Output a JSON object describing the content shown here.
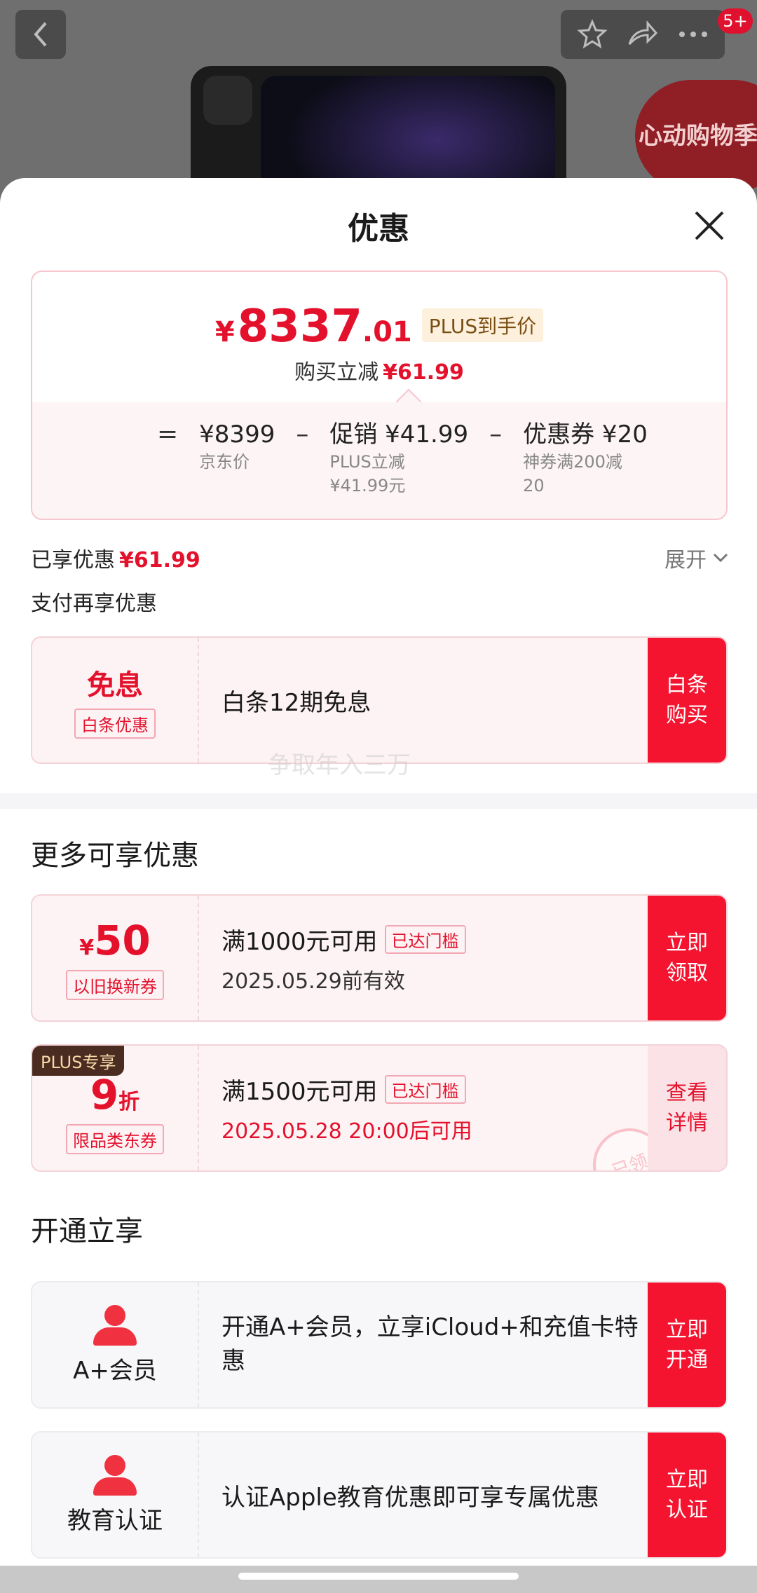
{
  "background": {
    "badge": "5+",
    "promo_text": "心动购物季"
  },
  "sheet": {
    "title": "优惠"
  },
  "price": {
    "symbol": "¥",
    "integer": "8337",
    "decimal": ".01",
    "plus_tag": "PLUS到手价",
    "sub_label": "购买立减",
    "sub_value": "¥61.99",
    "formula": {
      "eq": "=",
      "minus": "–",
      "items": [
        {
          "value": "¥8399",
          "desc": "京东价"
        },
        {
          "value": "促销 ¥41.99",
          "desc": "PLUS立减\n¥41.99元"
        },
        {
          "value": "优惠券 ¥20",
          "desc": "神券满200减\n20"
        }
      ]
    }
  },
  "enjoyed": {
    "label": "已享优惠",
    "value": "¥61.99",
    "expand": "展开"
  },
  "pay_section": {
    "title": "支付再享优惠",
    "card": {
      "left_title": "免息",
      "left_tag": "白条优惠",
      "text": "白条12期免息",
      "button": "白条\n购买"
    }
  },
  "watermark": "争取年入三万",
  "more_section": {
    "title": "更多可享优惠",
    "coupons": [
      {
        "amount_symbol": "¥",
        "amount": "50",
        "tag": "以旧换新券",
        "title": "满1000元可用",
        "threshold": "已达门槛",
        "sub": "2025.05.29前有效",
        "button": "立即\n领取"
      },
      {
        "corner": "PLUS专享",
        "amount": "9",
        "unit": "折",
        "tag": "限品类东券",
        "title": "满1500元可用",
        "threshold": "已达门槛",
        "sub": "2025.05.28 20:00后可用",
        "button": "查看\n详情",
        "stamp": "已领"
      }
    ]
  },
  "open_section": {
    "title": "开通立享",
    "items": [
      {
        "label": "A+会员",
        "text": "开通A+会员，立享iCloud+和充值卡特惠",
        "button": "立即\n开通"
      },
      {
        "label": "教育认证",
        "text": "认证Apple教育优惠即可享专属优惠",
        "button": "立即\n认证"
      }
    ]
  },
  "colors": {
    "accent_red": "#f4142f",
    "price_red": "#e4112c",
    "plus_brown": "#4a2d20"
  }
}
